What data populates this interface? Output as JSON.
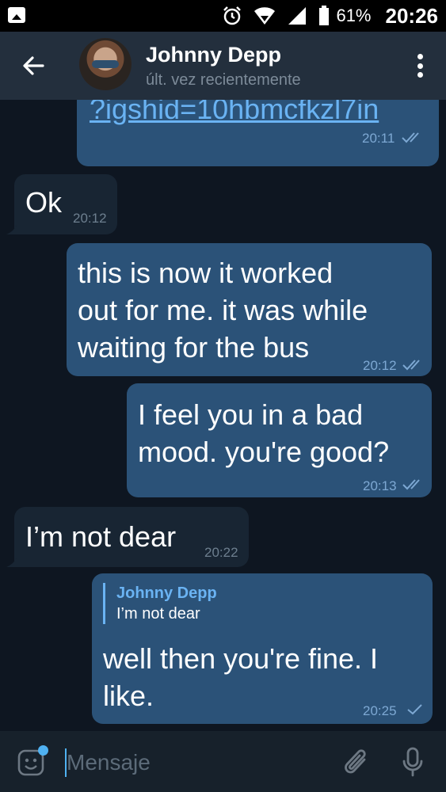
{
  "status_bar": {
    "battery_percent": "61%",
    "time": "20:26"
  },
  "header": {
    "title": "Johnny Depp",
    "subtitle": "últ. vez recientemente"
  },
  "messages": [
    {
      "dir": "out",
      "text": "?igshid=10hbmcfkzl7in",
      "time": "20:11",
      "status": "read",
      "is_link": true
    },
    {
      "dir": "in",
      "text": "Ok",
      "time": "20:12"
    },
    {
      "dir": "out",
      "lines": [
        "this is now it worked",
        "out for me. it was while",
        "waiting for the bus"
      ],
      "time": "20:12",
      "status": "read"
    },
    {
      "dir": "out",
      "lines": [
        "I feel you in a bad",
        "mood. you're good?"
      ],
      "time": "20:13",
      "status": "read"
    },
    {
      "dir": "in",
      "text": "I’m not dear",
      "time": "20:22"
    },
    {
      "dir": "out",
      "reply_to": {
        "name": "Johnny Depp",
        "text": "I’m not dear"
      },
      "lines": [
        "well then you're fine. I",
        "like."
      ],
      "time": "20:25",
      "status": "sent"
    }
  ],
  "input": {
    "placeholder": "Mensaje"
  },
  "icons": [
    "back-arrow-icon",
    "more-vertical-icon",
    "emoji-icon",
    "attach-icon",
    "mic-icon",
    "alarm-icon",
    "wifi-icon",
    "signal-icon",
    "battery-icon"
  ],
  "colors": {
    "background": "#0e1621",
    "header": "#232f3d",
    "outgoing": "#2b5278",
    "incoming": "#182533",
    "accent": "#6ab3f3"
  }
}
